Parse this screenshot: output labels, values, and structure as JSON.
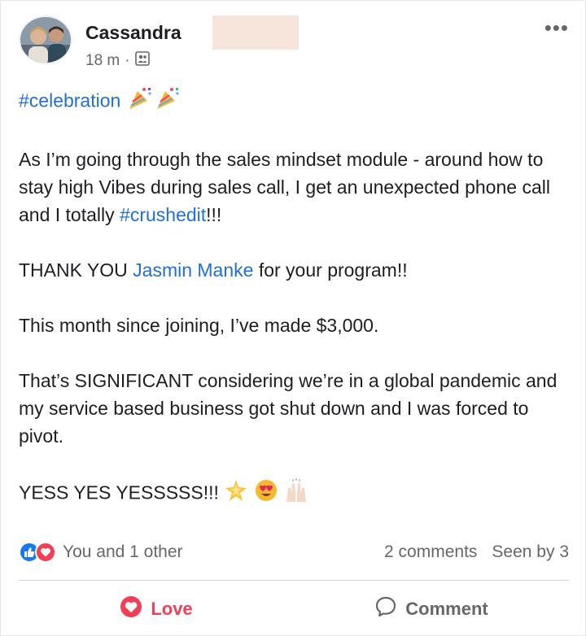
{
  "post": {
    "author": "Cassandra",
    "time": "18 m",
    "separator": "·",
    "audience_icon": "group-audience-icon",
    "more_icon": "more-options-icon",
    "body": {
      "hashtag_celebration": "#celebration",
      "p1_a": "As I’m going through the sales mindset module - around how to stay high Vibes during sales call, I get an unexpected phone call and I totally ",
      "p1_link": "#crushedit",
      "p1_b": "!!!",
      "p2_a": "THANK YOU ",
      "p2_link": "Jasmin Manke",
      "p2_b": " for your program!!",
      "p3": "This month since joining, I’ve made $3,000.",
      "p4": "That’s SIGNIFICANT considering we’re in a global pandemic and my service based business got shut down and I was forced to pivot.",
      "p5": "YESS YES YESSSSS!!!"
    },
    "reactions": {
      "summary": "You and 1 other",
      "comments": "2 comments",
      "seen": "Seen by 3"
    },
    "actions": {
      "love_label": "Love",
      "comment_label": "Comment"
    }
  },
  "colors": {
    "link": "#216fdb",
    "love": "#f33e58",
    "like": "#1877f2",
    "muted": "#65676b"
  }
}
